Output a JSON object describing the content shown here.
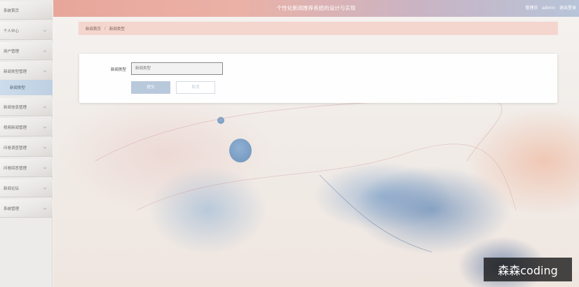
{
  "app": {
    "title": "个性化新闻推荐系统的设计与实现",
    "user_role": "管理员",
    "username": "admin",
    "logout": "退出登录"
  },
  "sidebar": {
    "items": [
      {
        "label": "系统首页"
      },
      {
        "label": "个人中心"
      },
      {
        "label": "用户管理"
      },
      {
        "label": "新闻类型管理"
      },
      {
        "label": "新闻信息管理"
      },
      {
        "label": "视频新闻管理"
      },
      {
        "label": "问卷调查管理"
      },
      {
        "label": "问卷回答管理"
      },
      {
        "label": "新闻论坛"
      },
      {
        "label": "系统管理"
      }
    ],
    "active_sub": "新闻类型"
  },
  "breadcrumb": {
    "home": "新闻首页",
    "separator": "/",
    "current": "新闻类型"
  },
  "form": {
    "field_label": "新闻类型",
    "field_placeholder": "新闻类型",
    "submit_label": "提交",
    "cancel_label": "取消"
  },
  "watermark": "森森coding",
  "colors": {
    "topbar_start": "#e8a69a",
    "topbar_end": "#b7c4d9",
    "breadcrumb_bg": "#f4d6cf",
    "submit_bg": "#b9c9dc",
    "active_sub_bg": "#c6d7e8"
  }
}
